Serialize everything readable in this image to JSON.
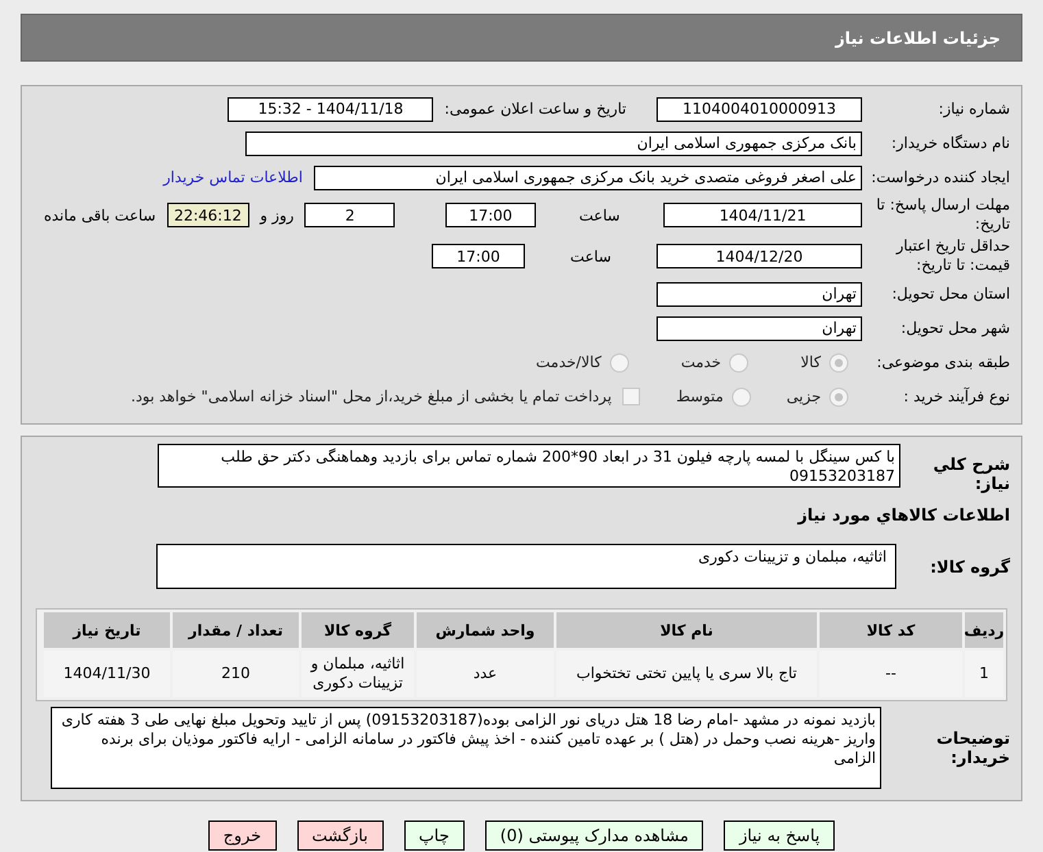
{
  "header": {
    "title": "جزئیات اطلاعات نیاز"
  },
  "need_number": {
    "label": "شماره نیاز:",
    "value": "1104004010000913"
  },
  "announce": {
    "label": "تاریخ و ساعت اعلان عمومی:",
    "value": "1404/11/18 - 15:32"
  },
  "buyer_org": {
    "label": "نام دستگاه خریدار:",
    "value": "بانک مرکزی جمهوری اسلامی ایران"
  },
  "requester": {
    "label": "ایجاد کننده درخواست:",
    "value": "علی اصغر فروغی متصدی خرید بانک مرکزی جمهوری اسلامی ایران",
    "link": "اطلاعات تماس خریدار"
  },
  "response_deadline": {
    "label": "مهلت ارسال پاسخ: تا تاریخ:",
    "date": "1404/11/21",
    "time_label": "ساعت",
    "time": "17:00",
    "days": "2",
    "days_suffix": "روز و",
    "remaining": "22:46:12",
    "remaining_suffix": "ساعت باقی مانده"
  },
  "price_validity": {
    "label": "حداقل تاریخ اعتبار قیمت: تا تاریخ:",
    "date": "1404/12/20",
    "time_label": "ساعت",
    "time": "17:00"
  },
  "province": {
    "label": "استان محل تحویل:",
    "value": "تهران"
  },
  "city": {
    "label": "شهر محل تحویل:",
    "value": "تهران"
  },
  "category": {
    "label": "طبقه بندی موضوعی:",
    "options": [
      {
        "label": "کالا",
        "selected": true
      },
      {
        "label": "خدمت",
        "selected": false
      },
      {
        "label": "کالا/خدمت",
        "selected": false
      }
    ]
  },
  "process": {
    "label": "نوع فرآیند خرید :",
    "options": [
      {
        "label": "جزیی",
        "selected": true
      },
      {
        "label": "متوسط",
        "selected": false
      }
    ],
    "treasury": {
      "checked": false,
      "label": "پرداخت تمام یا بخشی از مبلغ خرید،از محل \"اسناد خزانه اسلامی\" خواهد بود."
    }
  },
  "description": {
    "label": "شرح کلي نياز:",
    "value": "با کس سینگل با لمسه پارچه فیلون 31 در ابعاد 90*200  شماره تماس برای بازدید وهماهنگی دکتر حق طلب 09153203187"
  },
  "goods_title": "اطلاعات کالاهاي مورد نياز",
  "goods_group": {
    "label": "گروه کالا:",
    "value": "اثاثیه، مبلمان و تزیینات دکوری"
  },
  "table": {
    "columns": [
      "ردیف",
      "کد کالا",
      "نام کالا",
      "واحد شمارش",
      "گروه کالا",
      "تعداد / مقدار",
      "تاریخ نیاز"
    ],
    "rows": [
      [
        "1",
        "--",
        "تاج بالا سری یا پایین تختی تختخواب",
        "عدد",
        "اثاثیه، مبلمان و تزیینات دکوری",
        "210",
        "1404/11/30"
      ]
    ]
  },
  "buyer_notes": {
    "label": "توضیحات خریدار:",
    "value": "بازدید نمونه در مشهد -امام رضا 18 هتل دریای نور الزامی بوده(09153203187) پس از تایید وتحویل مبلغ نهایی طی 3 هفته کاری واریز -هرینه نصب وحمل در (هتل ) بر عهده تامین کننده - اخذ پیش فاکتور در سامانه الزامی - ارایه فاکتور موذیان برای برنده الزامی"
  },
  "buttons": [
    {
      "label": "پاسخ به نیاز",
      "kind": "normal"
    },
    {
      "label": "مشاهده مدارک پیوستی (0)",
      "kind": "normal"
    },
    {
      "label": "چاپ",
      "kind": "normal"
    },
    {
      "label": "بازگشت",
      "kind": "danger"
    },
    {
      "label": "خروج",
      "kind": "danger"
    }
  ]
}
